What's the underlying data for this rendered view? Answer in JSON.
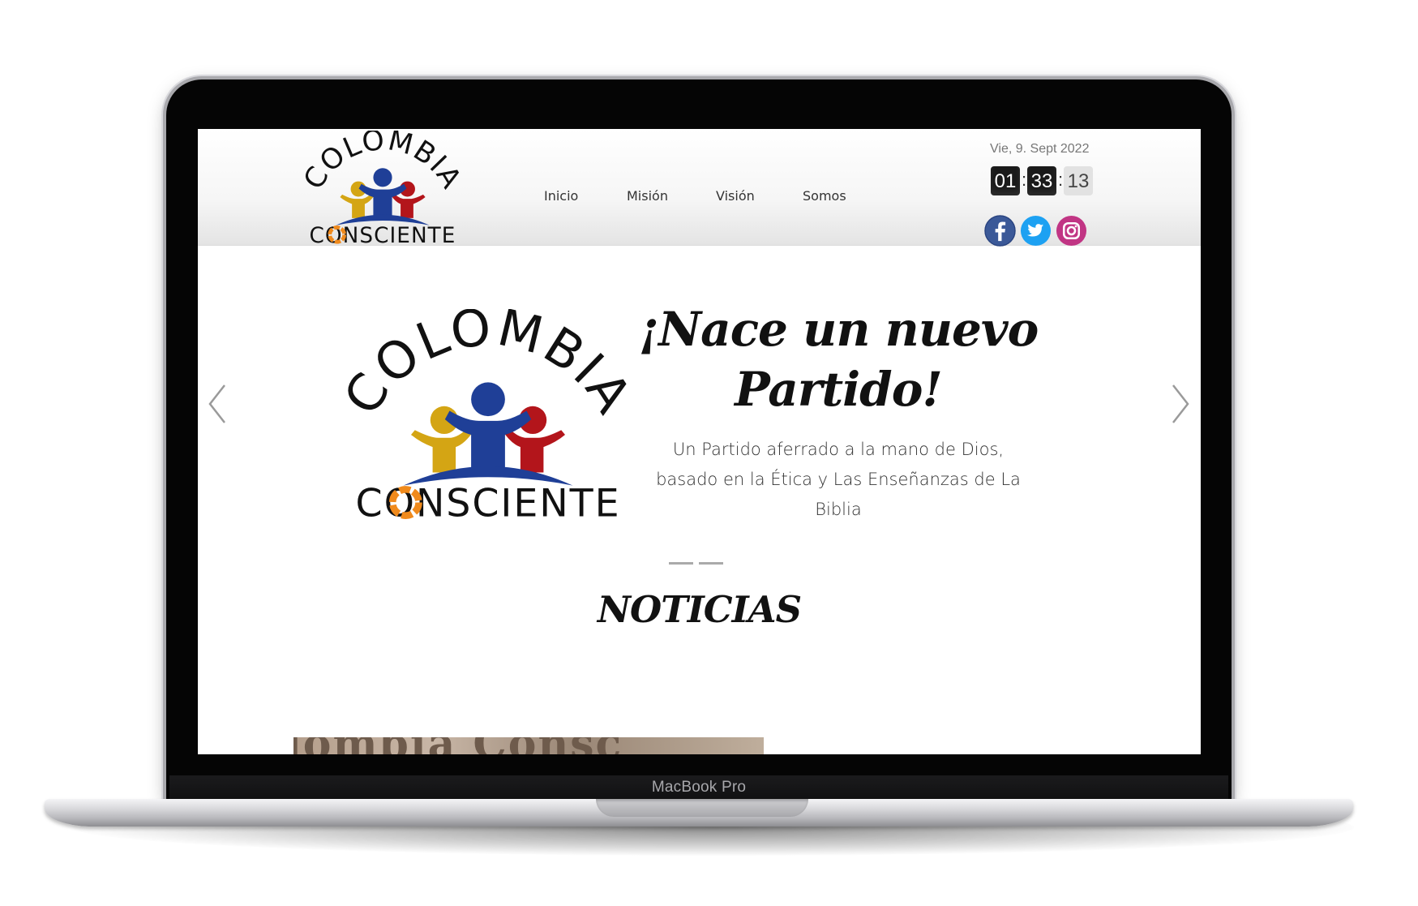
{
  "device": {
    "label": "MacBook Pro"
  },
  "brand": {
    "line1": "COLOMBIA",
    "line2": "CONSCIENTE"
  },
  "nav": {
    "items": [
      {
        "label": "Inicio"
      },
      {
        "label": "Misión"
      },
      {
        "label": "Visión"
      },
      {
        "label": "Somos"
      }
    ]
  },
  "header": {
    "date": "Vie, 9. Sept 2022",
    "clock": {
      "hours": "01",
      "minutes": "33",
      "seconds": "13",
      "separator": ":"
    }
  },
  "social": {
    "icons": [
      {
        "name": "facebook-icon",
        "color": "#3b5998"
      },
      {
        "name": "twitter-icon",
        "color": "#1da1f2"
      },
      {
        "name": "instagram-icon",
        "color": "#c13584"
      }
    ]
  },
  "hero": {
    "title_line1": "¡Nace un nuevo",
    "title_line2": "Partido!",
    "text_line1": "Un Partido aferrado a la mano de Dios,",
    "text_line2": "basado en la Ética y Las Enseñanzas de La",
    "text_line3": "Biblia",
    "slide_count": 2
  },
  "news": {
    "title": "NOTICIAS",
    "thumb_text": "lombia Consc"
  },
  "colors": {
    "yellow": "#d4a514",
    "blue": "#1f3f97",
    "red": "#b3151b",
    "orange": "#f08a1c"
  }
}
